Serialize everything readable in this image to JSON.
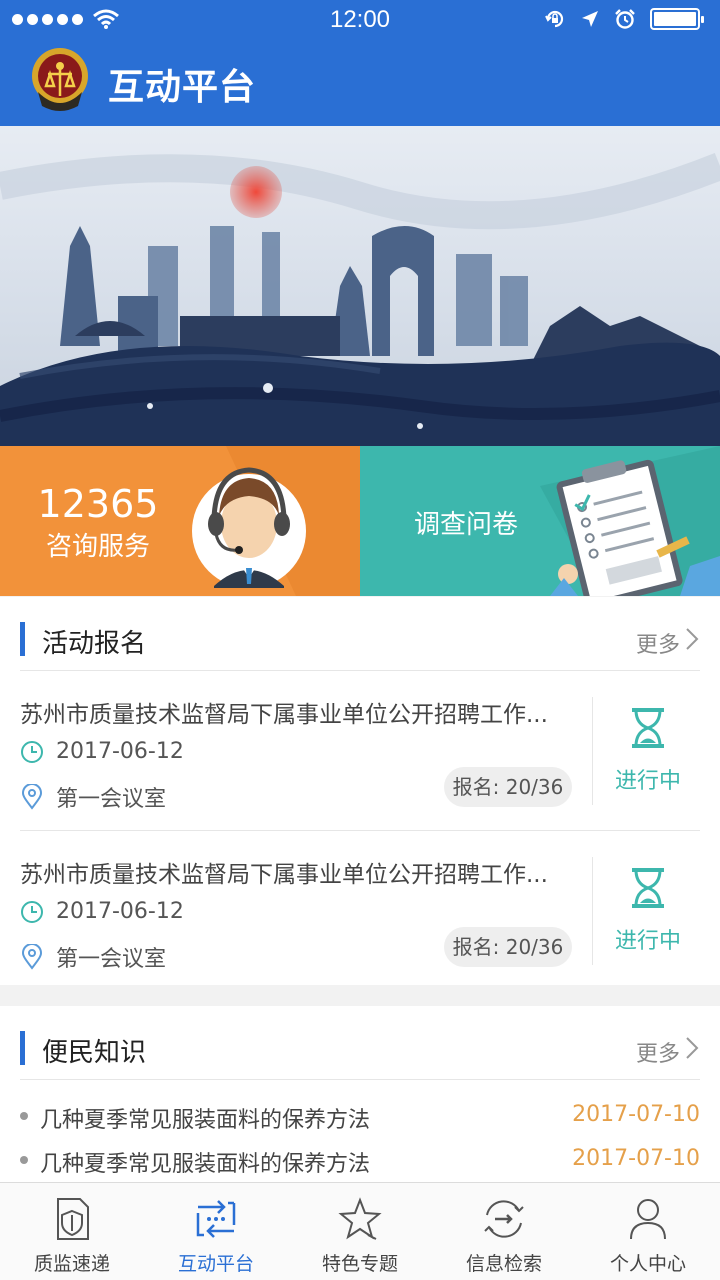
{
  "status_bar": {
    "time": "12:00"
  },
  "header": {
    "title": "互动平台"
  },
  "tiles": {
    "consult": {
      "number": "12365",
      "label": "咨询服务"
    },
    "survey": {
      "label": "调查问卷"
    }
  },
  "activities": {
    "title": "活动报名",
    "more": "更多",
    "items": [
      {
        "title": "苏州市质量技术监督局下属事业单位公开招聘工作...",
        "date": "2017-06-12",
        "place": "第一会议室",
        "signup": "报名: 20/36",
        "status": "进行中"
      },
      {
        "title": "苏州市质量技术监督局下属事业单位公开招聘工作...",
        "date": "2017-06-12",
        "place": "第一会议室",
        "signup": "报名: 20/36",
        "status": "进行中"
      }
    ]
  },
  "knowledge": {
    "title": "便民知识",
    "more": "更多",
    "items": [
      {
        "title": "几种夏季常见服装面料的保养方法",
        "date": "2017-07-10"
      },
      {
        "title": "几种夏季常见服装面料的保养方法",
        "date": "2017-07-10"
      }
    ]
  },
  "tabbar": {
    "items": [
      {
        "label": "质监速递",
        "icon": "shield-doc-icon"
      },
      {
        "label": "互动平台",
        "icon": "interaction-icon"
      },
      {
        "label": "特色专题",
        "icon": "star-icon"
      },
      {
        "label": "信息检索",
        "icon": "search-cycle-icon"
      },
      {
        "label": "个人中心",
        "icon": "person-icon"
      }
    ],
    "active_index": 1
  },
  "colors": {
    "primary": "#2a6fd4",
    "orange": "#f2923a",
    "teal": "#3db7ad",
    "date_orange": "#e5a04a"
  }
}
